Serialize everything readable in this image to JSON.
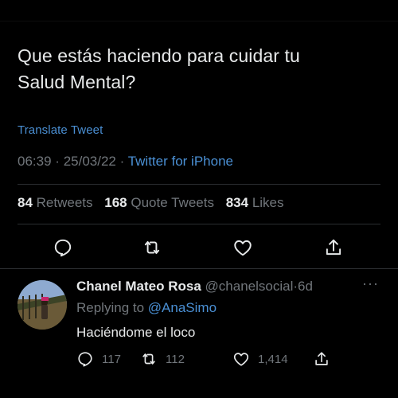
{
  "tweet": {
    "text_line1": "Que estás haciendo para cuidar tu",
    "text_line2": "Salud Mental?",
    "translate_label": "Translate Tweet",
    "time": "06:39",
    "date": "25/03/22",
    "separator": "·",
    "source": "Twitter for iPhone",
    "stats": {
      "retweets_count": "84",
      "retweets_label": "Retweets",
      "quote_count": "168",
      "quote_label": "Quote Tweets",
      "likes_count": "834",
      "likes_label": "Likes"
    },
    "actions": [
      "reply-icon",
      "retweet-icon",
      "like-icon",
      "share-icon"
    ]
  },
  "reply": {
    "name": "Chanel Mateo Rosa",
    "handle": "@chanelsocial",
    "separator": "·",
    "age": "6d",
    "more": "···",
    "replying_to_label": "Replying to",
    "replying_to_handle": "@AnaSimo",
    "text": "Haciéndome el loco",
    "reply_count": "117",
    "retweet_count": "112",
    "like_count": "1,414"
  },
  "colors": {
    "background": "#000000",
    "text": "#e7e9ea",
    "muted": "#71767b",
    "link": "#4a8fd3",
    "divider": "#2b2e31"
  }
}
